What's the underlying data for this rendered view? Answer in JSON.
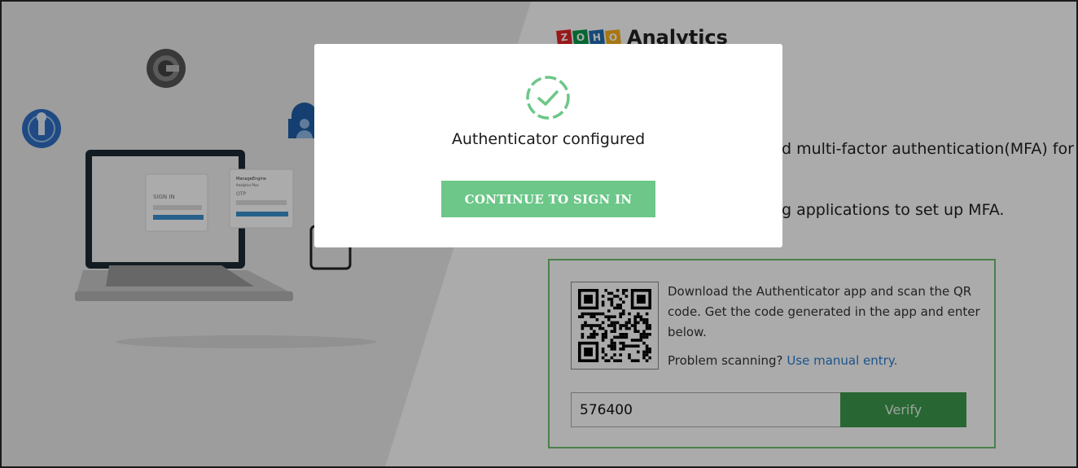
{
  "brand": {
    "logo_letters": [
      "Z",
      "O",
      "H",
      "O"
    ],
    "logo_colors": [
      "#e42527",
      "#089949",
      "#226db4",
      "#f9b21d"
    ],
    "product": "Analytics"
  },
  "background": {
    "description_line1": "d multi-factor authentication(MFA) for",
    "description_line2": "g applications to set up MFA.",
    "illustration": {
      "signin_label": "SIGN IN",
      "otp_brand": "ManageEngine",
      "otp_product": "Analytics Plus",
      "otp_label": "OTP"
    }
  },
  "qr_card": {
    "instructions": "Download the Authenticator app and scan the QR code. Get the code generated in the app and enter below.",
    "problem_text": "Problem scanning?",
    "manual_entry_link": "Use manual entry.",
    "code_value": "576400",
    "verify_label": "Verify"
  },
  "modal": {
    "title": "Authenticator configured",
    "continue_label": "CONTINUE TO SIGN IN",
    "icon": "check-circle-icon",
    "accent": "#6cc788"
  }
}
